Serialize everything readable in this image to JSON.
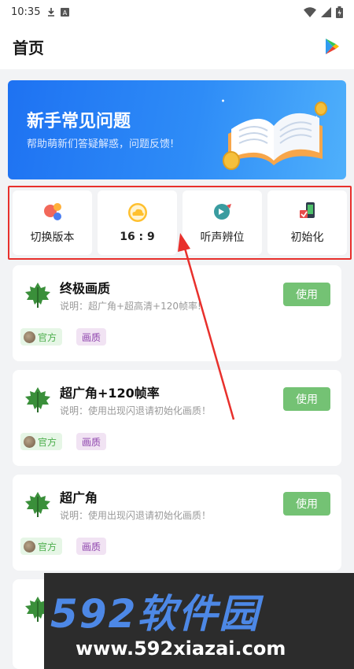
{
  "status_bar": {
    "time": "10:35",
    "icons": [
      "download-icon",
      "a-box-icon",
      "wifi-icon",
      "signal-icon",
      "battery-icon"
    ]
  },
  "app_bar": {
    "title": "首页",
    "action_icon": "play-store-icon"
  },
  "banner": {
    "title": "新手常见问题",
    "subtitle": "帮助萌新们答疑解惑，问题反馈!"
  },
  "quick_actions": [
    {
      "label": "切换版本",
      "icon": "switch-icon"
    },
    {
      "label": "16 : 9",
      "icon": "cloud-icon"
    },
    {
      "label": "听声辨位",
      "icon": "sound-icon"
    },
    {
      "label": "初始化",
      "icon": "init-icon"
    }
  ],
  "cards": [
    {
      "title": "终极画质",
      "desc": "说明：超广角+超高清+120帧率!",
      "button": "使用",
      "tag_official": "官方",
      "tag_quality": "画质"
    },
    {
      "title": "超广角+120帧率",
      "desc": "说明：使用出现闪退请初始化画质！",
      "button": "使用",
      "tag_official": "官方",
      "tag_quality": "画质"
    },
    {
      "title": "超广角",
      "desc": "说明：使用出现闪退请初始化画质！",
      "button": "使用",
      "tag_official": "官方",
      "tag_quality": "画质"
    }
  ],
  "watermark": {
    "title": "592软件园",
    "url": "www.592xiazai.com"
  },
  "colors": {
    "banner": "#2e8cf7",
    "highlight_border": "#e8302c",
    "use_button": "#5cb85c",
    "tag_official": "#e6f6e6",
    "tag_quality": "#f1e3f3"
  }
}
